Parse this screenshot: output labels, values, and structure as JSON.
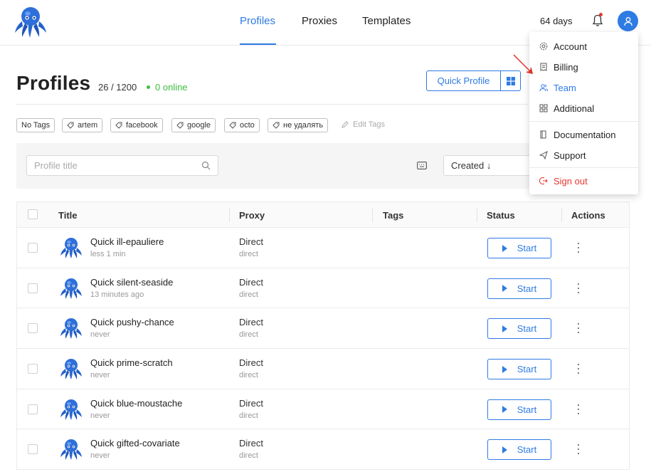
{
  "nav": {
    "tabs": [
      {
        "label": "Profiles",
        "active": true
      },
      {
        "label": "Proxies",
        "active": false
      },
      {
        "label": "Templates",
        "active": false
      }
    ],
    "days_left": "64 days"
  },
  "header": {
    "title": "Profiles",
    "count": "26 / 1200",
    "online": "0 online",
    "quick_profile_label": "Quick Profile"
  },
  "tags": [
    "No Tags",
    "artem",
    "facebook",
    "google",
    "octo",
    "не удалять"
  ],
  "edit_tags_label": "Edit Tags",
  "search": {
    "placeholder": "Profile title"
  },
  "sort": {
    "value": "Created ↓"
  },
  "table": {
    "columns": [
      "Title",
      "Proxy",
      "Tags",
      "Status",
      "Actions"
    ],
    "start_label": "Start",
    "rows": [
      {
        "title": "Quick ill-epauliere",
        "sub": "less 1 min",
        "proxy": "Direct",
        "proxy_sub": "direct"
      },
      {
        "title": "Quick silent-seaside",
        "sub": "13 minutes ago",
        "proxy": "Direct",
        "proxy_sub": "direct"
      },
      {
        "title": "Quick pushy-chance",
        "sub": "never",
        "proxy": "Direct",
        "proxy_sub": "direct"
      },
      {
        "title": "Quick prime-scratch",
        "sub": "never",
        "proxy": "Direct",
        "proxy_sub": "direct"
      },
      {
        "title": "Quick blue-moustache",
        "sub": "never",
        "proxy": "Direct",
        "proxy_sub": "direct"
      },
      {
        "title": "Quick gifted-covariate",
        "sub": "never",
        "proxy": "Direct",
        "proxy_sub": "direct"
      }
    ]
  },
  "menu": {
    "items": [
      {
        "label": "Account",
        "icon": "gear-icon"
      },
      {
        "label": "Billing",
        "icon": "receipt-icon"
      },
      {
        "label": "Team",
        "icon": "team-icon"
      },
      {
        "label": "Additional",
        "icon": "grid-icon"
      },
      {
        "label": "Documentation",
        "icon": "book-icon"
      },
      {
        "label": "Support",
        "icon": "send-icon"
      },
      {
        "label": "Sign out",
        "icon": "logout-icon"
      }
    ]
  },
  "colors": {
    "accent": "#2e7be4",
    "online": "#3fbd3f",
    "danger": "#e8372e"
  }
}
